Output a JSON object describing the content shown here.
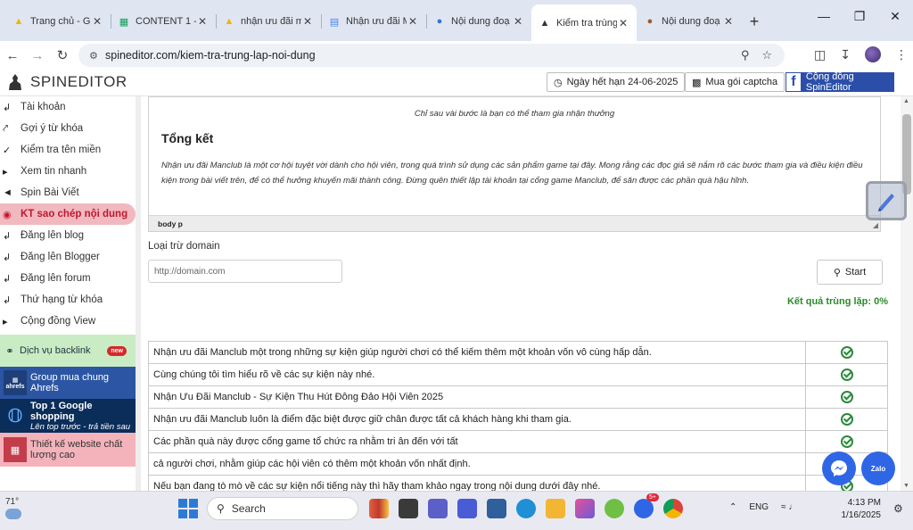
{
  "browser": {
    "tabs": [
      {
        "title": "Trang chủ - Go",
        "icon": "google-drive-icon",
        "color": "#f4b400",
        "active": false
      },
      {
        "title": "CONTENT 1 -",
        "icon": "google-sheets-icon",
        "color": "#0f9d58",
        "active": false
      },
      {
        "title": "nhận ưu đãi m",
        "icon": "google-drive-icon",
        "color": "#f4b400",
        "active": false
      },
      {
        "title": "Nhận ưu đãi M",
        "icon": "google-docs-icon",
        "color": "#4285f4",
        "active": false
      },
      {
        "title": "Nội dung đoạ",
        "icon": "quillbot-icon",
        "color": "#3b6fd4",
        "active": false
      },
      {
        "title": "Kiểm tra trùng",
        "icon": "spineditor-icon",
        "color": "#333333",
        "active": true
      },
      {
        "title": "Nội dung đoạ",
        "icon": "quillbot-icon",
        "color": "#a05a2c",
        "active": false
      }
    ],
    "url": "spineditor.com/kiem-tra-trung-lap-noi-dung"
  },
  "header": {
    "logo_text": "SPINEDITOR",
    "expiry_label": "Ngày hết hạn 24-06-2025",
    "captcha_label": "Mua gói captcha",
    "community_label": "Cộng đồng SpinEditor",
    "fb_glyph": "f"
  },
  "sidebar": {
    "items": [
      {
        "label": "Tài khoản"
      },
      {
        "label": "Gợi ý từ khóa"
      },
      {
        "label": "Kiểm tra tên miền"
      },
      {
        "label": "Xem tin nhanh"
      },
      {
        "label": "Spin Bài Viết"
      },
      {
        "label": "KT sao chép nội dung"
      },
      {
        "label": "Đăng lên blog"
      },
      {
        "label": "Đăng lên Blogger"
      },
      {
        "label": "Đăng lên forum"
      },
      {
        "label": "Thứ hạng từ khóa"
      },
      {
        "label": "Cộng đồng View"
      }
    ],
    "promos": [
      {
        "label": "Dịch vụ backlink",
        "badge": "new"
      },
      {
        "label": "Group mua chung Ahrefs",
        "icon_text": "ahrefs"
      },
      {
        "label": "Top 1 Google shopping",
        "sublabel": "Lên top trước - trả tiền sau"
      },
      {
        "label": "Thiết kế website chất lượng cao"
      }
    ]
  },
  "editor": {
    "caption": "Chỉ sau vài bước là bạn có thể tham gia nhận thưởng",
    "heading": "Tổng kết",
    "paragraph": "Nhận ưu đãi Manclub là một cơ hội tuyệt vời dành cho hội viên, trong quá trình sử dụng các sản phẩm game tại đây. Mong rằng các đọc giả sẽ nắm rõ các bước tham gia và điều kiện điều kiện trong bài viết trên, để có thể hưởng khuyến mãi thành công. Đừng quên thiết lập tài khoản tại cổng game Manclub, để săn được các phần quà hậu hĩnh.",
    "status_path": "body  p"
  },
  "form": {
    "exclude_label": "Loại trừ domain",
    "domain_placeholder": "http://domain.com",
    "start_label": "Start",
    "result_text": "Kết quả trùng lặp: 0%"
  },
  "results": [
    {
      "text": "Nhận ưu đãi Manclub một trong những sự kiện giúp người chơi có thể kiếm thêm một khoản vốn vô cùng hấp dẫn."
    },
    {
      "text": "Cùng chúng tôi tìm hiểu rõ về các sự kiện này nhé."
    },
    {
      "text": "Nhận Ưu Đãi Manclub - Sự Kiện Thu Hút Đông Đảo Hội Viên 2025"
    },
    {
      "text": "Nhận ưu đãi Manclub luôn là điểm đặc biệt được giữ chân được tất cả khách hàng khi tham gia."
    },
    {
      "text": "Các phần quà này được cổng game tổ chức ra nhằm tri ân đến với tất"
    },
    {
      "text": "cả người chơi, nhằm giúp các hội viên có thêm một khoản vốn nhất định."
    },
    {
      "text": "Nếu bạn đang tò mò về các sự kiện nổi tiếng này thì hãy tham khảo ngay trong nội dung dưới đây nhé."
    }
  ],
  "floating": {
    "zalo_label": "Zalo"
  },
  "taskbar": {
    "weather": "71°",
    "search_label": "Search",
    "language": "ENG",
    "time": "4:13 PM",
    "date": "1/16/2025",
    "zalo_badge": "5+"
  }
}
